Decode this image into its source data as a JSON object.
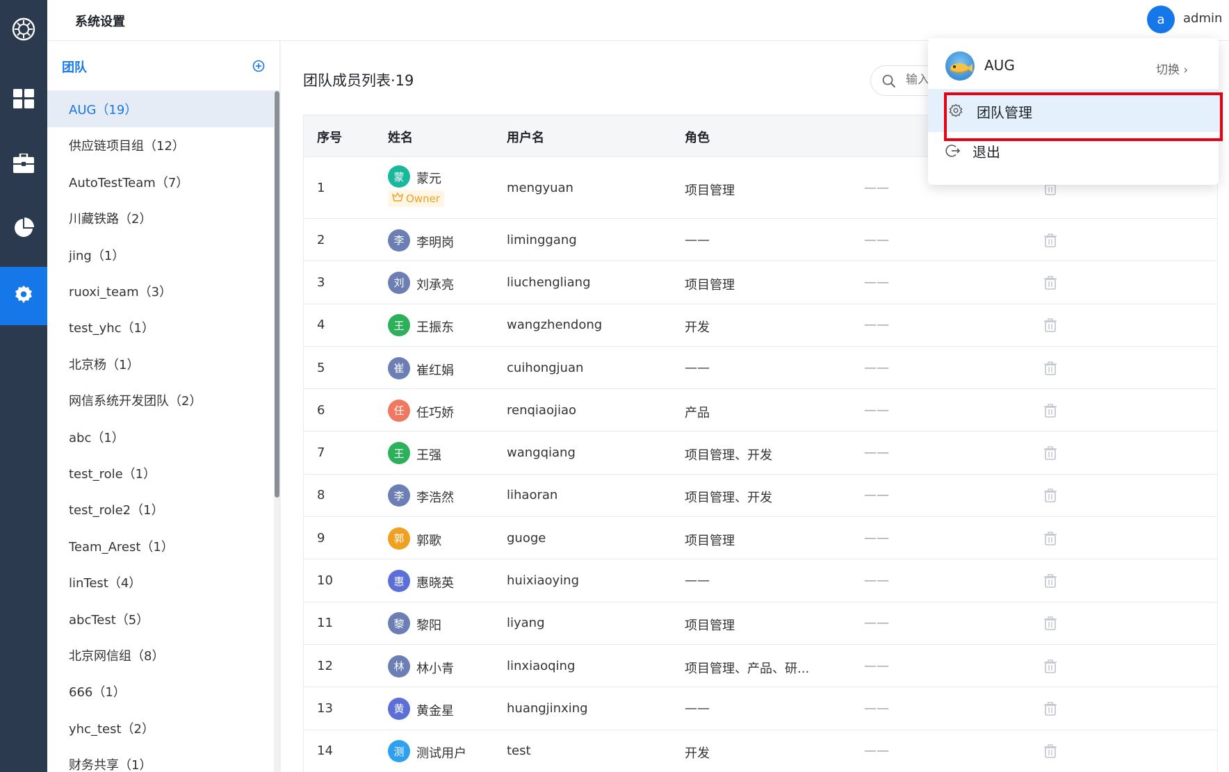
{
  "header": {
    "title": "系统设置",
    "user_initial": "a",
    "user_name": "admin"
  },
  "nav": {
    "items": [
      {
        "icon": "logo-icon"
      },
      {
        "icon": "dashboard-icon"
      },
      {
        "icon": "briefcase-icon"
      },
      {
        "icon": "pie-chart-icon"
      },
      {
        "icon": "settings-icon",
        "active": true
      }
    ],
    "active_color": "#1677e8"
  },
  "team_panel": {
    "title": "团队",
    "teams": [
      {
        "label": "AUG（19）",
        "active": true
      },
      {
        "label": "供应链项目组（12）"
      },
      {
        "label": "AutoTestTeam（7）"
      },
      {
        "label": "川藏铁路（2）"
      },
      {
        "label": "jing（1）"
      },
      {
        "label": "ruoxi_team（3）"
      },
      {
        "label": "test_yhc（1）"
      },
      {
        "label": "北京杨（1）"
      },
      {
        "label": "网信系统开发团队（2）"
      },
      {
        "label": "abc（1）"
      },
      {
        "label": "test_role（1）"
      },
      {
        "label": "test_role2（1）"
      },
      {
        "label": "Team_Arest（1）"
      },
      {
        "label": "linTest（4）"
      },
      {
        "label": "abcTest（5）"
      },
      {
        "label": "北京网信组（8）"
      },
      {
        "label": "666（1）"
      },
      {
        "label": "yhc_test（2）"
      },
      {
        "label": "财务共享（1）"
      }
    ]
  },
  "main": {
    "title": "团队成员列表·19",
    "search": {
      "placeholder": "输入"
    },
    "columns": [
      "序号",
      "姓名",
      "用户名",
      "角色"
    ],
    "owner_label": "Owner",
    "empty_value": "——",
    "rows": [
      {
        "no": "1",
        "initial": "蒙",
        "name": "蒙元",
        "username": "mengyuan",
        "role": "项目管理",
        "color": "#19b89a",
        "owner": true
      },
      {
        "no": "2",
        "initial": "李",
        "name": "李明岗",
        "username": "liminggang",
        "role": "——",
        "color": "#6b7fb5"
      },
      {
        "no": "3",
        "initial": "刘",
        "name": "刘承亮",
        "username": "liuchengliang",
        "role": "项目管理",
        "color": "#6b7fb5"
      },
      {
        "no": "4",
        "initial": "王",
        "name": "王振东",
        "username": "wangzhendong",
        "role": "开发",
        "color": "#2db05a"
      },
      {
        "no": "5",
        "initial": "崔",
        "name": "崔红娟",
        "username": "cuihongjuan",
        "role": "——",
        "color": "#6b7fb5"
      },
      {
        "no": "6",
        "initial": "任",
        "name": "任巧娇",
        "username": "renqiaojiao",
        "role": "产品",
        "color": "#f07860"
      },
      {
        "no": "7",
        "initial": "王",
        "name": "王强",
        "username": "wangqiang",
        "role": "项目管理、开发",
        "color": "#2db05a"
      },
      {
        "no": "8",
        "initial": "李",
        "name": "李浩然",
        "username": "lihaoran",
        "role": "项目管理、开发",
        "color": "#6b7fb5"
      },
      {
        "no": "9",
        "initial": "郭",
        "name": "郭歌",
        "username": "guoge",
        "role": "项目管理",
        "color": "#f0a020"
      },
      {
        "no": "10",
        "initial": "惠",
        "name": "惠晓英",
        "username": "huixiaoying",
        "role": "——",
        "color": "#5b6fd6"
      },
      {
        "no": "11",
        "initial": "黎",
        "name": "黎阳",
        "username": "liyang",
        "role": "项目管理",
        "color": "#6b7fb5"
      },
      {
        "no": "12",
        "initial": "林",
        "name": "林小青",
        "username": "linxiaoqing",
        "role": "项目管理、产品、研...",
        "color": "#6b7fb5"
      },
      {
        "no": "13",
        "initial": "黄",
        "name": "黄金星",
        "username": "huangjinxing",
        "role": "——",
        "color": "#5b6fd6"
      },
      {
        "no": "14",
        "initial": "测",
        "name": "测试用户",
        "username": "test",
        "role": "开发",
        "color": "#2f9ff0"
      }
    ]
  },
  "dropdown": {
    "team_name": "AUG",
    "switch_label": "切换 ›",
    "items": [
      {
        "label": "团队管理",
        "icon": "settings-icon",
        "highlighted": true
      },
      {
        "label": "退出",
        "icon": "logout-icon"
      }
    ]
  }
}
